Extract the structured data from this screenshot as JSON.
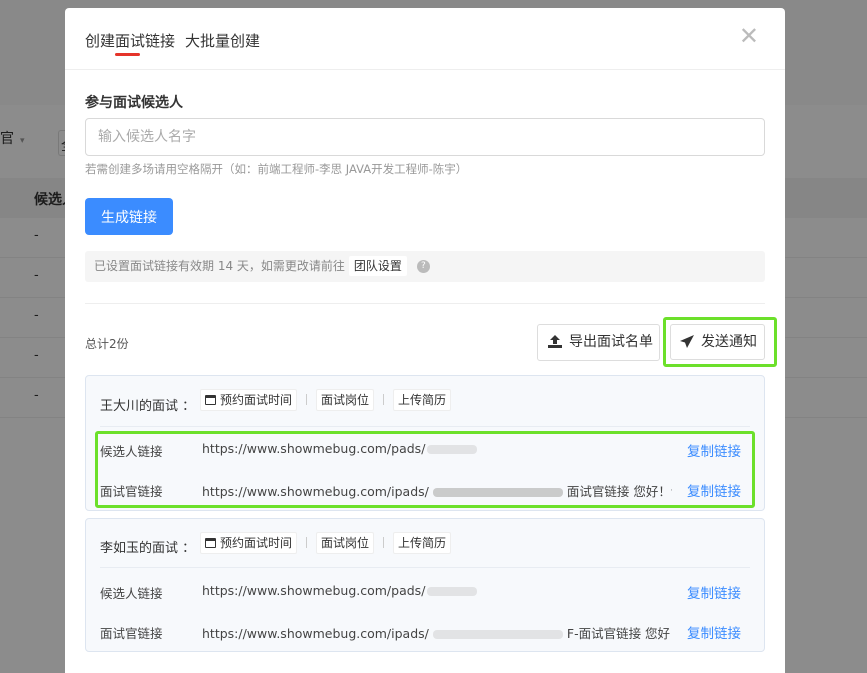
{
  "background": {
    "filter_label": "官",
    "filter_caret": "▾",
    "filter_label2": "全",
    "column_header": "候选人",
    "rows": [
      "-",
      "-",
      "-",
      "-",
      "-"
    ]
  },
  "modal": {
    "tabs": [
      {
        "label": "创建面试链接"
      },
      {
        "label": "大批量创建"
      }
    ],
    "close_glyph": "✕",
    "section_label": "参与面试候选人",
    "input_placeholder": "输入候选人名字",
    "input_value": "",
    "hint": "若需创建多场请用空格隔开（如：前端工程师-李思 JAVA开发工程师-陈宇）",
    "generate_button": "生成链接",
    "info_text": "已设置面试链接有效期 14 天，如需更改请前往",
    "team_settings_link": "团队设置",
    "help_glyph": "?",
    "total": "总计2份",
    "export_button": "导出面试名单",
    "notify_button": "发送通知",
    "interviews": [
      {
        "title": "王大川的面试 ：",
        "chips": [
          "预约面试时间",
          "面试岗位",
          "上传简历"
        ],
        "candidate_label": "候选人链接",
        "candidate_url": "https://www.showmebug.com/pads/",
        "interviewer_label": "面试官链接",
        "interviewer_url": "https://www.showmebug.com/ipads/",
        "interviewer_suffix": "面试官链接 您好！请复...",
        "copy_label": "复制链接"
      },
      {
        "title": "李如玉的面试 ：",
        "chips": [
          "预约面试时间",
          "面试岗位",
          "上传简历"
        ],
        "candidate_label": "候选人链接",
        "candidate_url": "https://www.showmebug.com/pads/",
        "interviewer_label": "面试官链接",
        "interviewer_url": "https://www.showmebug.com/ipads/",
        "interviewer_suffix": "F-面试官链接 您好！请复...",
        "copy_label": "复制链接"
      }
    ]
  },
  "colors": {
    "primary": "#3b8cff",
    "accent_underline": "#e5342a",
    "highlight": "#6ce02a"
  },
  "icons": [
    "close-icon",
    "help-icon",
    "upload-icon",
    "send-icon",
    "calendar-icon"
  ]
}
